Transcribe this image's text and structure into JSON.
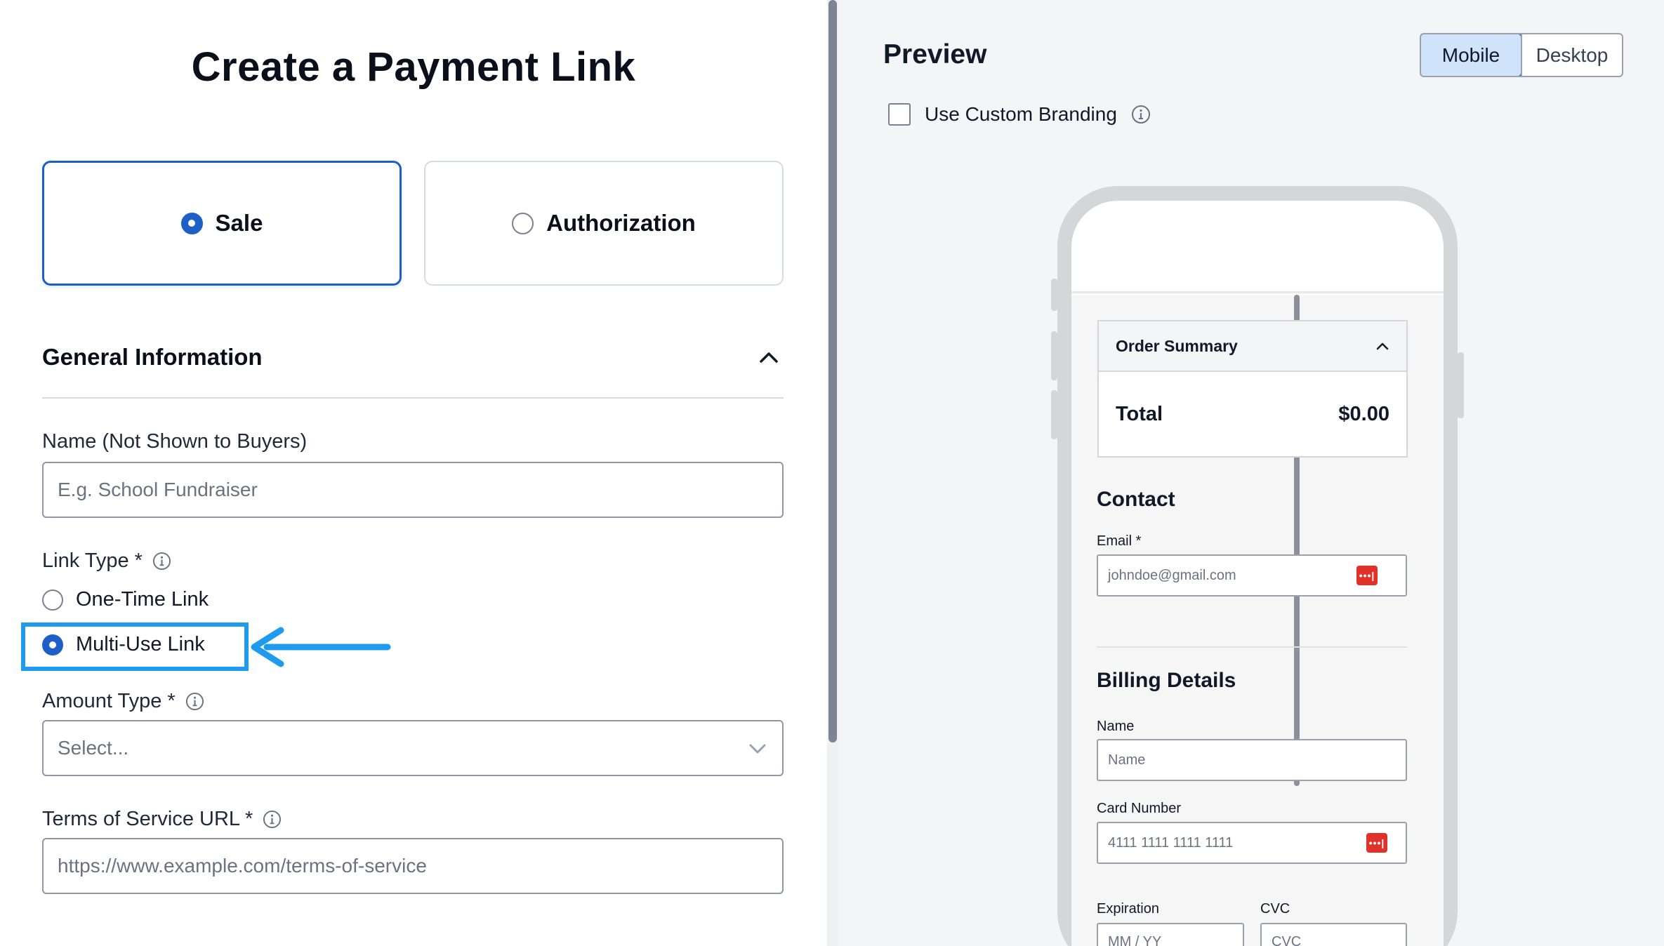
{
  "form": {
    "title": "Create a Payment Link",
    "payment_types": [
      {
        "label": "Sale",
        "selected": true
      },
      {
        "label": "Authorization",
        "selected": false
      }
    ],
    "section": {
      "title": "General Information",
      "expanded": true
    },
    "name_field": {
      "label": "Name (Not Shown to Buyers)",
      "placeholder": "E.g. School Fundraiser",
      "value": ""
    },
    "link_type": {
      "label": "Link Type *",
      "options": [
        {
          "label": "One-Time Link",
          "selected": false
        },
        {
          "label": "Multi-Use Link",
          "selected": true
        }
      ]
    },
    "amount_type": {
      "label": "Amount Type *",
      "placeholder": "Select..."
    },
    "tos_field": {
      "label": "Terms of Service URL *",
      "placeholder": "https://www.example.com/terms-of-service",
      "value": ""
    }
  },
  "preview": {
    "title": "Preview",
    "view_modes": [
      {
        "label": "Mobile",
        "active": true
      },
      {
        "label": "Desktop",
        "active": false
      }
    ],
    "custom_branding": {
      "label": "Use Custom Branding",
      "checked": false
    },
    "phone": {
      "order_summary": {
        "title": "Order Summary",
        "total_label": "Total",
        "total_value": "$0.00"
      },
      "contact": {
        "heading": "Contact",
        "email_label": "Email *",
        "email_placeholder": "johndoe@gmail.com"
      },
      "billing": {
        "heading": "Billing Details",
        "name_label": "Name",
        "name_placeholder": "Name",
        "card_label": "Card Number",
        "card_placeholder": "4111 1111 1111 1111",
        "expiration_label": "Expiration",
        "expiration_placeholder": "MM / YY",
        "cvc_label": "CVC",
        "cvc_placeholder": "CVC"
      },
      "password_manager_icon_text": "•••|"
    }
  },
  "colors": {
    "accent": "#1d5fc7",
    "highlight_annotation": "#1e9bef",
    "password_icon": "#e0312b",
    "mobile_toggle_bg": "#cfe4fb"
  },
  "icons": [
    "info-icon",
    "chevron-up-icon",
    "chevron-down-icon",
    "arrow-left-icon",
    "password-manager-icon"
  ]
}
